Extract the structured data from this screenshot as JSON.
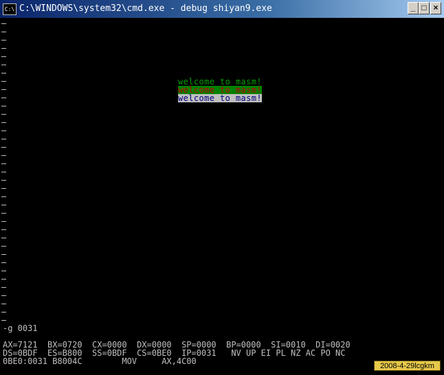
{
  "window": {
    "title": "C:\\WINDOWS\\system32\\cmd.exe - debug shiyan9.exe",
    "icon_label": "C:\\",
    "minimize_glyph": "_",
    "maximize_glyph": "□",
    "close_glyph": "×"
  },
  "screen": {
    "welcome_lines": [
      {
        "text": "welcome to masm!",
        "color": "#00a000",
        "background": "#000000"
      },
      {
        "text": "welcome to masm!",
        "color": "#c00000",
        "background": "#008000"
      },
      {
        "text": "welcome to masm!",
        "color": "#000080",
        "background": "#c0c0c0"
      }
    ],
    "command": "-g 0031",
    "registers_line1": "AX=7121  BX=0720  CX=0000  DX=0000  SP=0000  BP=0000  SI=0010  DI=0020",
    "registers_line2": "DS=0BDF  ES=B800  SS=0BDF  CS=0BE0  IP=0031   NV UP EI PL NZ AC PO NC",
    "instruction_line": "0BE0:0031 B8004C        MOV     AX,4C00"
  },
  "watermark": {
    "text": "2008-4-29lcgkm",
    "color": "#e6c84a"
  }
}
